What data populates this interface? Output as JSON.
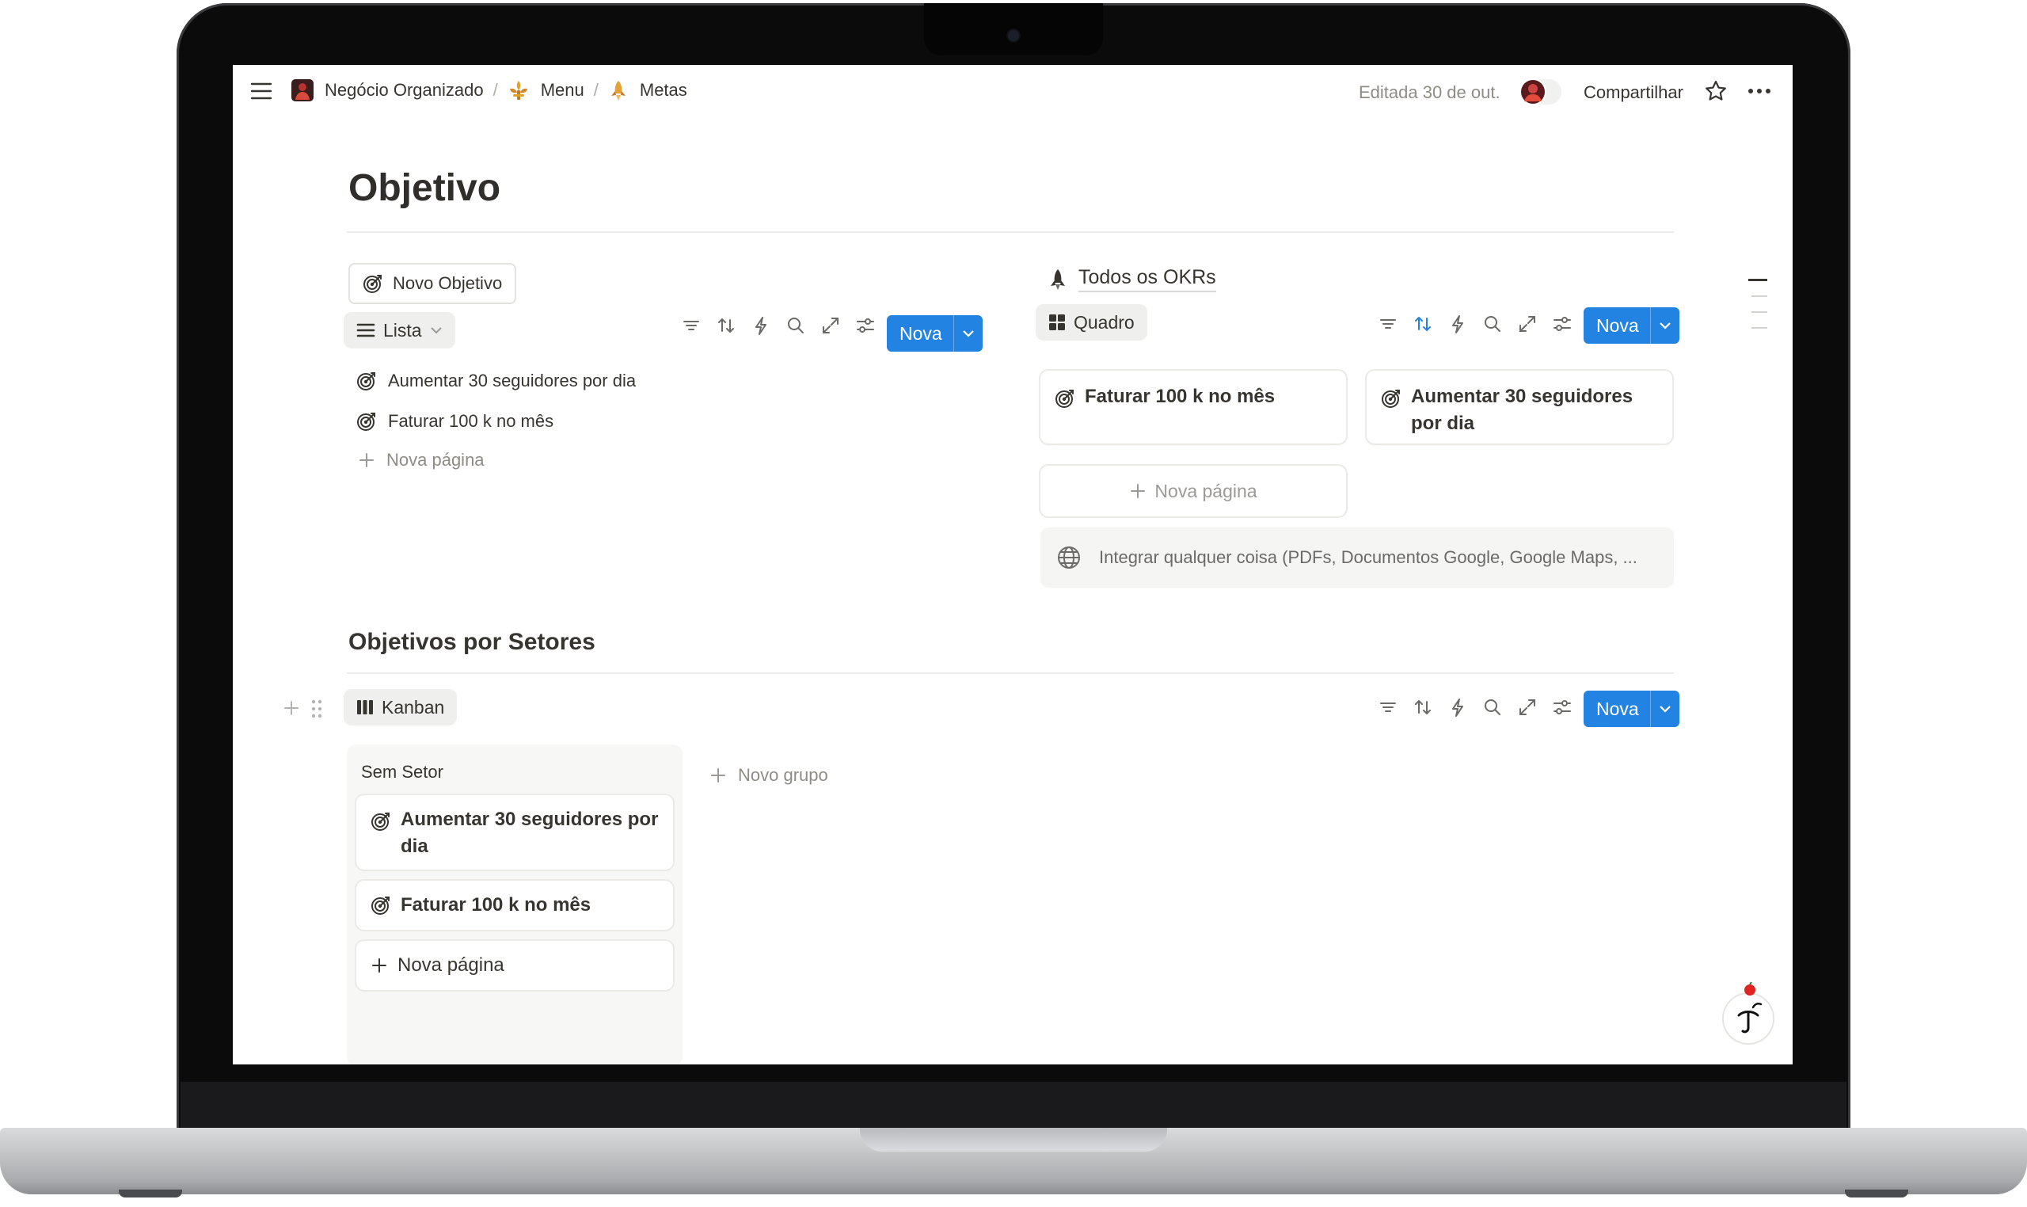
{
  "topbar": {
    "breadcrumbs": [
      {
        "label": "Negócio Organizado",
        "icon": "workspace-avatar-icon"
      },
      {
        "label": "Menu",
        "icon": "fleur-de-lis-icon"
      },
      {
        "label": "Metas",
        "icon": "rocket-icon"
      }
    ],
    "separator": "/",
    "edited": "Editada 30 de out.",
    "share_label": "Compartilhar"
  },
  "page": {
    "title": "Objetivo"
  },
  "left_panel": {
    "new_button_label": "Novo Objetivo",
    "view_label": "Lista",
    "nova_label": "Nova",
    "items": [
      {
        "label": "Aumentar 30 seguidores por dia",
        "icon": "target-icon"
      },
      {
        "label": "Faturar 100 k no mês",
        "icon": "target-icon"
      }
    ],
    "add_label": "Nova página"
  },
  "right_panel": {
    "db_title": "Todos os OKRs",
    "view_label": "Quadro",
    "nova_label": "Nova",
    "cards": [
      {
        "label": "Faturar 100 k no mês",
        "icon": "target-icon"
      },
      {
        "label": "Aumentar 30 seguidores por dia",
        "icon": "target-icon"
      }
    ],
    "add_label": "Nova página",
    "embed_label": "Integrar qualquer coisa (PDFs, Documentos Google, Google Maps, ..."
  },
  "section": {
    "heading": "Objetivos por Setores",
    "view_label": "Kanban",
    "nova_label": "Nova",
    "group_name": "Sem Setor",
    "cards": [
      {
        "label": "Aumentar 30 seguidores por dia",
        "icon": "target-icon"
      },
      {
        "label": "Faturar 100 k no mês",
        "icon": "target-icon"
      }
    ],
    "add_label": "Nova página",
    "new_group_label": "Novo grupo"
  },
  "colors": {
    "accent": "#2383e2",
    "text": "#37352f",
    "muted": "#9b9a97"
  }
}
